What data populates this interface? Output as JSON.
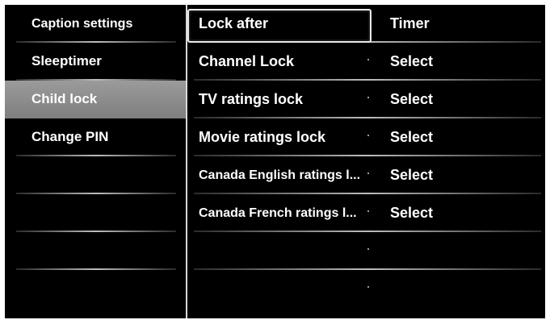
{
  "left_menu": {
    "items": [
      {
        "label": "Caption settings",
        "selected": false
      },
      {
        "label": "Sleeptimer",
        "selected": false
      },
      {
        "label": "Child lock",
        "selected": true
      },
      {
        "label": "Change PIN",
        "selected": false
      },
      {
        "label": "",
        "selected": false
      },
      {
        "label": "",
        "selected": false
      },
      {
        "label": "",
        "selected": false
      },
      {
        "label": "",
        "selected": false
      }
    ]
  },
  "child_lock": {
    "rows": [
      {
        "name": "Lock after",
        "value": "Timer",
        "focused": true
      },
      {
        "name": "Channel Lock",
        "value": "Select",
        "focused": false
      },
      {
        "name": "TV ratings lock",
        "value": "Select",
        "focused": false
      },
      {
        "name": "Movie ratings lock",
        "value": "Select",
        "focused": false
      },
      {
        "name": "Canada English ratings l...",
        "value": "Select",
        "focused": false
      },
      {
        "name": "Canada French ratings l...",
        "value": "Select",
        "focused": false
      },
      {
        "name": "",
        "value": "",
        "focused": false
      },
      {
        "name": "",
        "value": "",
        "focused": false
      }
    ]
  },
  "colors": {
    "background": "#000000",
    "text": "#ffffff",
    "selection": "#8e8e8e",
    "focus_border": "#e8e8e8"
  }
}
